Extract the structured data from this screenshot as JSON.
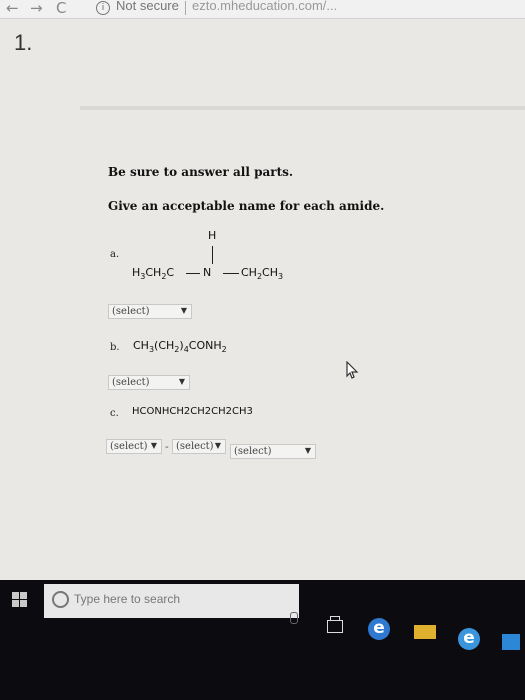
{
  "browser": {
    "back": "←",
    "forward": "→",
    "reload": "C",
    "info": "i",
    "security": "Not secure",
    "url": "ezto.mheducation.com/..."
  },
  "page_number": "1.",
  "instructions": {
    "line1": "Be sure to answer all parts.",
    "line2": "Give an acceptable name for each amide."
  },
  "parts": {
    "a": {
      "label": "a.",
      "h": "H",
      "left_group": "H3CH2C",
      "n": "N",
      "right_group": "CH2CH3",
      "select": "(select)"
    },
    "b": {
      "label": "b.",
      "formula": "CH3(CH2)4CONH2",
      "select": "(select)"
    },
    "c": {
      "label": "c.",
      "formula": "HCONHCH2CH2CH2CH3",
      "select1": "(select)",
      "dash": "-",
      "select2": "(select)",
      "select3": "(select)"
    }
  },
  "taskbar": {
    "search_placeholder": "Type here to search",
    "edge_letter": "e",
    "ie_letter": "e"
  }
}
